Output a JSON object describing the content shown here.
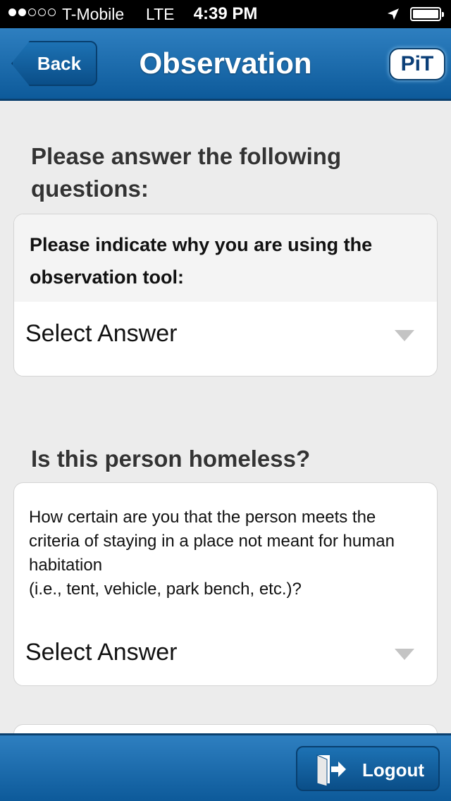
{
  "status_bar": {
    "signal_filled": 2,
    "signal_total": 5,
    "carrier": "T-Mobile",
    "network": "LTE",
    "time": "4:39 PM"
  },
  "nav": {
    "back_label": "Back",
    "title": "Observation",
    "logo_text": "PiT"
  },
  "sections": [
    {
      "heading": "Please answer the following questions:",
      "question": "Please indicate why you are using the observation tool:",
      "select_placeholder": "Select Answer"
    },
    {
      "heading": "Is this person homeless?",
      "question_line1": "How certain are you that the person meets the criteria of staying in a place not meant for human habitation",
      "question_line2": "(i.e., tent, vehicle, park bench, etc.)?",
      "select_placeholder": "Select Answer"
    }
  ],
  "bottom_bar": {
    "logout_label": "Logout"
  },
  "colors": {
    "nav_blue": "#1a6aad",
    "background": "#ececec"
  }
}
